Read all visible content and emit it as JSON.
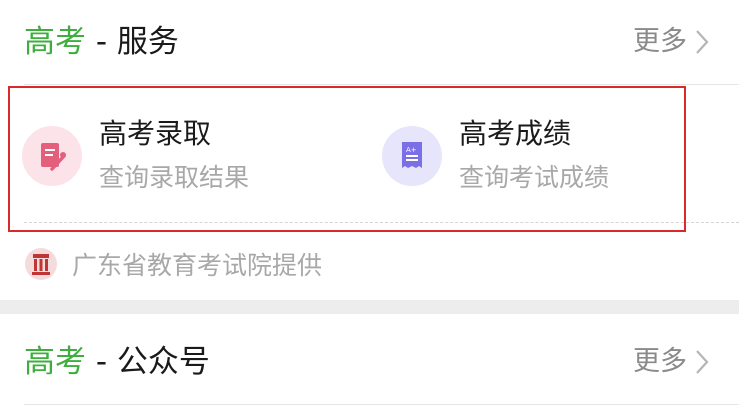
{
  "services": {
    "title_green": "高考",
    "title_rest": " - 服务",
    "more_label": "更多",
    "items": [
      {
        "title": "高考录取",
        "subtitle": "查询录取结果",
        "icon": "admission-document-icon",
        "color": "#e45f7c",
        "bg": "#fce3ea"
      },
      {
        "title": "高考成绩",
        "subtitle": "查询考试成绩",
        "icon": "score-receipt-icon",
        "color": "#7b6fe8",
        "bg": "#e7e5fb"
      }
    ],
    "provider": "广东省教育考试院提供"
  },
  "official_accounts": {
    "title_green": "高考",
    "title_rest": " - 公众号",
    "more_label": "更多"
  },
  "colors": {
    "accent_green": "#3fae3f",
    "highlight_red": "#d82a2a"
  }
}
